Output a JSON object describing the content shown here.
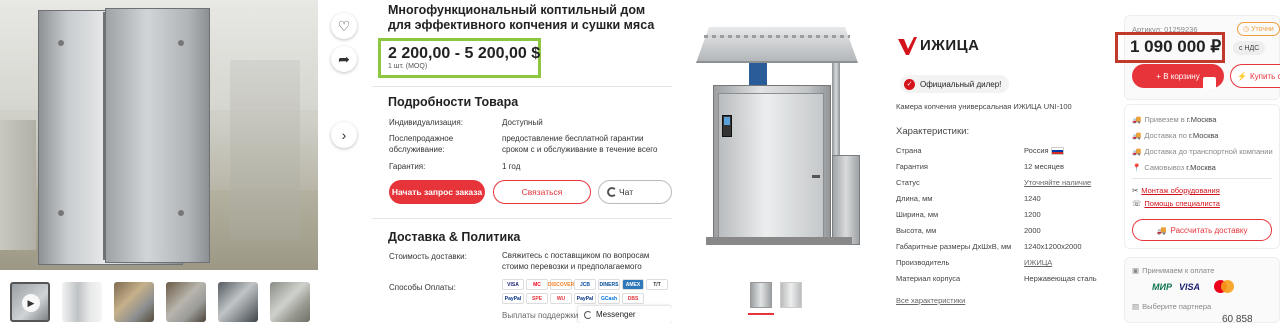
{
  "left_product": {
    "title": "Многофункциональный коптильный дом для эффективного копчения и сушки мяса",
    "price": "2 200,00 - 5 200,00 $",
    "moq": "1 шт. (MOQ)",
    "details_heading": "Подробности Товара",
    "details": [
      {
        "label": "Индивидуализация:",
        "value": "Доступный"
      },
      {
        "label": "Послепродажное обслуживание:",
        "value": "предоставление бесплатной гарантии сроком с и обслуживание в течение всего срока службы"
      },
      {
        "label": "Гарантия:",
        "value": "1 год"
      }
    ],
    "buttons": {
      "order": "Начать запрос заказа",
      "contact": "Связаться",
      "chat": "Чат"
    },
    "delivery_heading": "Доставка & Политика",
    "delivery_cost_label": "Стоимость доставки:",
    "delivery_cost_value": "Свяжитесь с поставщиком по вопросам стоимо перевозки и предполагаемого времени доставк",
    "payment_label": "Способы Оплаты:",
    "payment_methods": [
      "VISA",
      "MC",
      "DISCOVER",
      "JCB",
      "DINERS",
      "AMEX",
      "T/T",
      "PayPal",
      "SPE",
      "WU",
      "PayPal",
      "GCash",
      "DBS"
    ],
    "payment_support": "Выплаты поддержки в",
    "messenger": "Messenger",
    "icons": [
      "heart-icon",
      "share-icon",
      "chevron-right-icon"
    ]
  },
  "right_product": {
    "brand": "ИЖИЦА",
    "official_dealer": "Официальный дилер!",
    "product_name": "Камера копчения универсальная ИЖИЦА UNI-100",
    "specs_heading": "Характеристики:",
    "specs": [
      {
        "label": "Страна",
        "value": "Россия"
      },
      {
        "label": "Гарантия",
        "value": "12 месяцев"
      },
      {
        "label": "Статус",
        "value": "Уточняйте наличие"
      },
      {
        "label": "Длина, мм",
        "value": "1240"
      },
      {
        "label": "Ширина, мм",
        "value": "1200"
      },
      {
        "label": "Высота, мм",
        "value": "2000"
      },
      {
        "label": "Габаритные размеры ДхШхВ, мм",
        "value": "1240x1200x2000"
      },
      {
        "label": "Производитель",
        "value": "ИЖИЦА"
      },
      {
        "label": "Материал корпуса",
        "value": "Нержавеющая сталь"
      }
    ],
    "all_specs_link": "Все характеристики",
    "article": "Артикул: 01259236",
    "clarify": "Уточни",
    "price": "1 090 000 ₽",
    "vat": "с НДС",
    "cart_button": "+ В корзину",
    "buy_button": "Купить с",
    "delivery": [
      {
        "icon": "truck-icon",
        "text": "Привезем в",
        "value": "г.Москва"
      },
      {
        "icon": "truck-icon",
        "text": "Доставка по",
        "value": "г.Москва"
      },
      {
        "icon": "truck-icon",
        "text": "Доставка до транспортной компании",
        "value": ""
      },
      {
        "icon": "pin-icon",
        "text": "Самовывоз",
        "value": "г.Москва"
      }
    ],
    "services": [
      {
        "icon": "tools-icon",
        "text": "Монтаж оборудования"
      },
      {
        "icon": "phone-icon",
        "text": "Помощь специалиста"
      }
    ],
    "calc_delivery": "Рассчитать доставку",
    "accept_payment": "Принимаем к оплате",
    "payment_logos": [
      "МИР",
      "VISA",
      "MC"
    ],
    "choose_partner": "Выберите партнера",
    "partial_price": "60 858"
  },
  "colors": {
    "accent_red": "#e6343a",
    "green_frame": "#8dc63f",
    "dark_red_frame": "#c0392b"
  }
}
